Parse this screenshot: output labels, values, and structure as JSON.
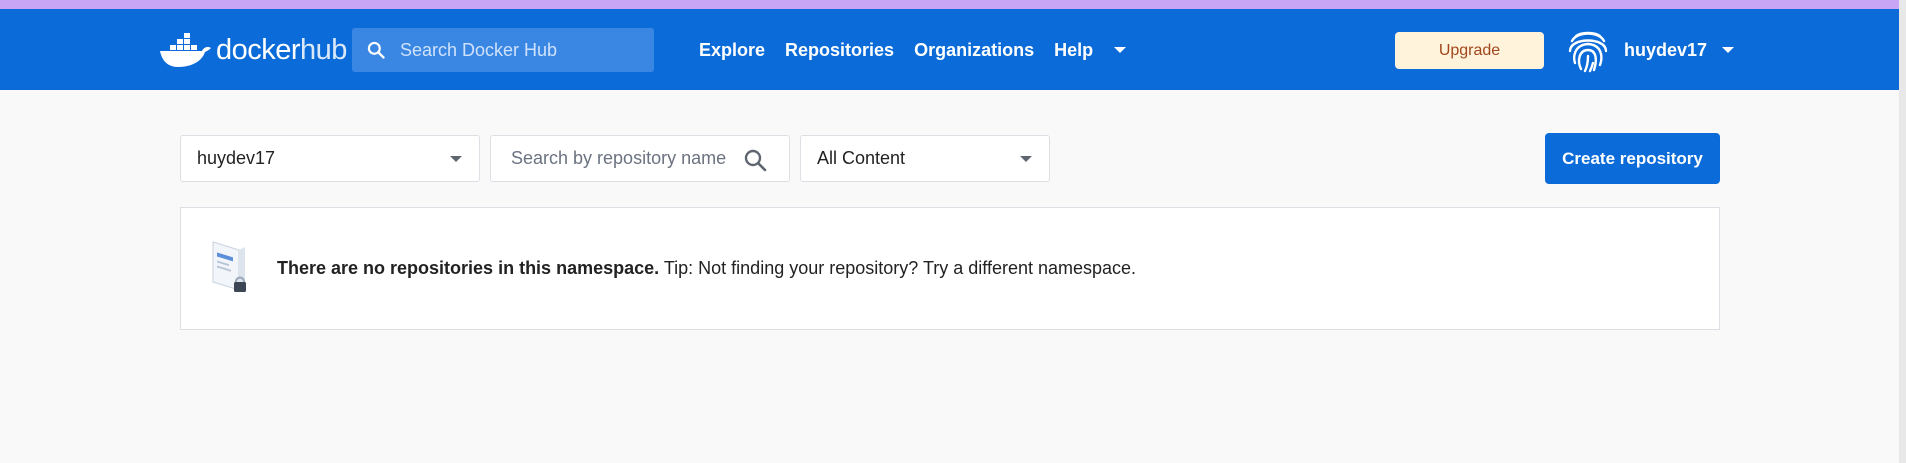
{
  "header": {
    "logo_primary": "docker",
    "logo_secondary": "hub",
    "search_placeholder": "Search Docker Hub",
    "nav": [
      {
        "label": "Explore"
      },
      {
        "label": "Repositories"
      },
      {
        "label": "Organizations"
      },
      {
        "label": "Help"
      }
    ],
    "upgrade_label": "Upgrade",
    "username": "huydev17"
  },
  "filters": {
    "namespace_value": "huydev17",
    "repo_search_placeholder": "Search by repository name",
    "content_value": "All Content"
  },
  "actions": {
    "create_label": "Create repository"
  },
  "empty_state": {
    "bold": "There are no repositories in this namespace.",
    "tip": " Tip: Not finding your repository? Try a different namespace."
  },
  "colors": {
    "brand_blue": "#0b6cd9",
    "accent_bar": "#c8a6f5",
    "upgrade_bg": "#fff3dc",
    "upgrade_text": "#a2461b"
  },
  "icons": {
    "logo": "docker-whale-icon",
    "search": "search-icon",
    "dropdown": "chevron-down-icon",
    "avatar": "fingerprint-icon",
    "empty": "locked-repository-icon"
  }
}
